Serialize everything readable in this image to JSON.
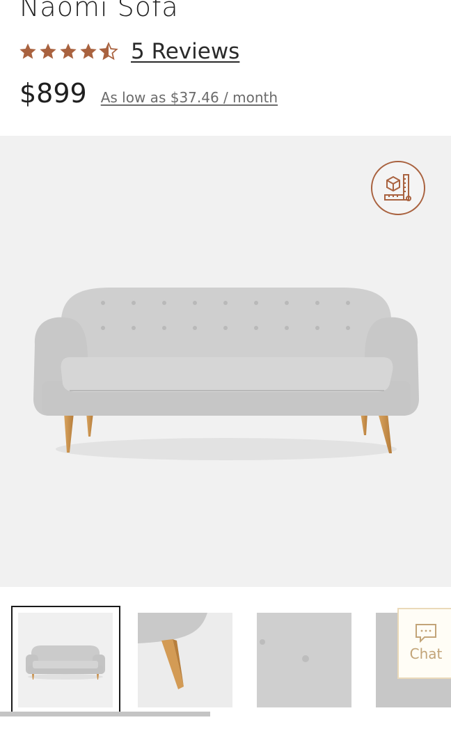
{
  "product": {
    "title": "Naomi Sofa",
    "rating": 4.5,
    "rating_max": 5,
    "reviews_label": "5 Reviews",
    "price": "$899",
    "financing_label": "As low as $37.46  / month"
  },
  "hero": {
    "ar_icon": "box-measure-icon",
    "image": "grey-tufted-sofa-wood-legs"
  },
  "thumbnails": [
    {
      "name": "front-view",
      "selected": true
    },
    {
      "name": "leg-detail",
      "selected": false
    },
    {
      "name": "tufting-detail",
      "selected": false
    },
    {
      "name": "fabric-detail",
      "selected": false
    }
  ],
  "chat": {
    "label": "Chat",
    "icon": "chat-bubble-icon"
  },
  "colors": {
    "accent": "#a9623f",
    "star": "#a9623f",
    "hero_bg": "#f1f1f1",
    "chat_text": "#c2a478"
  }
}
